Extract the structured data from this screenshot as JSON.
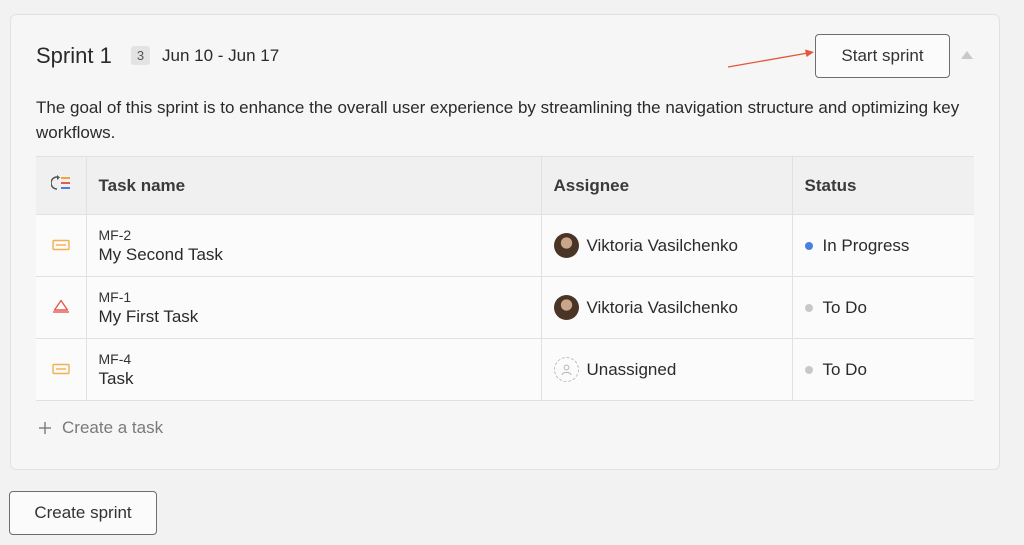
{
  "sprint": {
    "title": "Sprint 1",
    "task_count": "3",
    "dates": "Jun 10 - Jun 17",
    "start_label": "Start sprint",
    "goal": "The goal of this sprint is to enhance the overall user experience by streamlining the navigation structure and optimizing key workflows."
  },
  "table": {
    "columns": [
      "Task name",
      "Assignee",
      "Status"
    ],
    "rows": [
      {
        "key": "MF-2",
        "name": "My Second Task",
        "type_icon": "story-icon",
        "assignee": "Viktoria Vasilchenko",
        "status": "In Progress",
        "status_color": "#4a7fe0"
      },
      {
        "key": "MF-1",
        "name": "My First Task",
        "type_icon": "bug-icon",
        "assignee": "Viktoria Vasilchenko",
        "status": "To Do",
        "status_color": "#c8c8c8"
      },
      {
        "key": "MF-4",
        "name": "Task",
        "type_icon": "story-icon",
        "assignee": "Unassigned",
        "status": "To Do",
        "status_color": "#c8c8c8"
      }
    ]
  },
  "create_task_label": "Create a task",
  "create_sprint_label": "Create sprint",
  "colors": {
    "story": "#f2b04f",
    "bug": "#e45b4f",
    "arrow": "#e4553a"
  }
}
